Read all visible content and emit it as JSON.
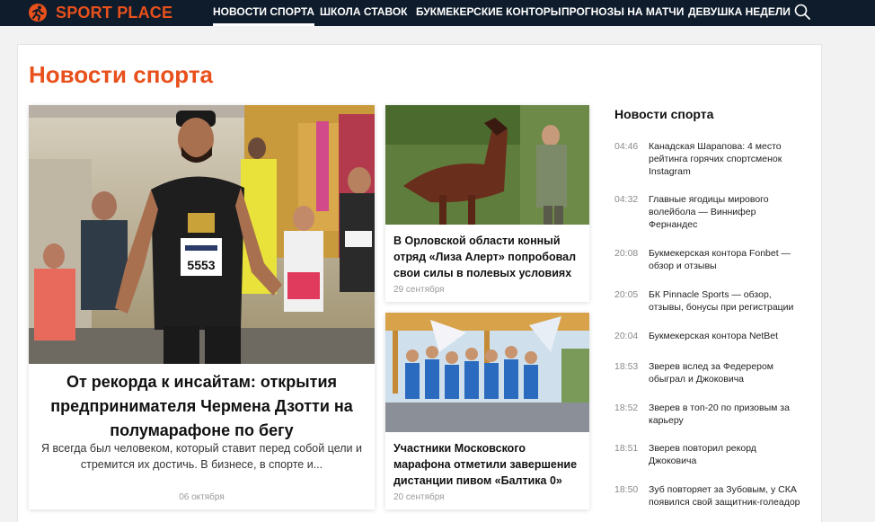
{
  "brand": {
    "name": "SPORT PLACE",
    "color": "#e8501c"
  },
  "nav": {
    "items": [
      {
        "label": "НОВОСТИ СПОРТА",
        "active": true
      },
      {
        "label": "ШКОЛА СТАВОК"
      },
      {
        "label": "БУКМЕКЕРСКИЕ КОНТОРЫ"
      },
      {
        "label": "ПРОГНОЗЫ НА МАТЧИ"
      },
      {
        "label": "ДЕВУШКА НЕДЕЛИ"
      }
    ],
    "search_icon": "search-icon"
  },
  "main": {
    "title": "Новости спорта",
    "hero": {
      "bib": "5553",
      "title": "От рекорда к инсайтам: открытия предпринимателя Чермена Дзотти на полумарафоне по бегу",
      "excerpt": "Я всегда был человеком, который ставит перед собой цели и стремится их достичь. В бизнесе, в спорте и...",
      "date": "06 октября"
    },
    "side_articles": [
      {
        "title": "В Орловской области конный отряд «Лиза Алерт» попробовал свои силы в полевых условиях",
        "date": "29 сентября"
      },
      {
        "title": "Участники Московского марафона отметили завершение дистанции пивом «Балтика 0»",
        "date": "20 сентября"
      }
    ]
  },
  "news_feed": {
    "title": "Новости спорта",
    "items": [
      {
        "time": "04:46",
        "text": "Канадская Шарапова: 4 место рейтинга горячих спортсменок Instagram"
      },
      {
        "time": "04:32",
        "text": "Главные ягодицы мирового волейбола — Виннифер Фернандес"
      },
      {
        "time": "20:08",
        "text": "Букмекерская контора Fonbet — обзор и отзывы"
      },
      {
        "time": "20:05",
        "text": "БК Pinnacle Sports — обзор, отзывы, бонусы при регистрации"
      },
      {
        "time": "20:04",
        "text": "Букмекерская контора NetBet"
      },
      {
        "time": "18:53",
        "text": "Зверев вслед за Федерером обыграл и Джоковича"
      },
      {
        "time": "18:52",
        "text": "Зверев в топ-20 по призовым за карьеру"
      },
      {
        "time": "18:51",
        "text": "Зверев повторил рекорд Джоковича"
      },
      {
        "time": "18:50",
        "text": "Зуб повторяет за Зубовым, у СКА появился свой защитник-голеадор"
      }
    ]
  }
}
